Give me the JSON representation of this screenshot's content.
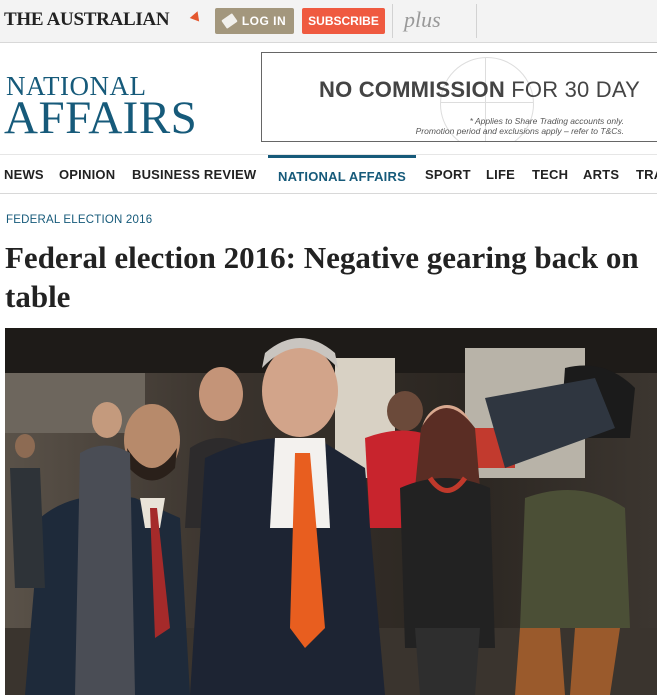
{
  "topbar": {
    "logo": "THE AUSTRALIAN",
    "login_label": "LOG IN",
    "subscribe_label": "SUBSCRIBE",
    "plus_label": "plus"
  },
  "masthead": {
    "section_line1": "NATIONAL",
    "section_line2": "AFFAIRS"
  },
  "ad": {
    "headline_bold": "NO COMMISSION",
    "headline_rest": " FOR 30 DAY",
    "fine_print_1": "* Applies to Share Trading accounts only.",
    "fine_print_2": "Promotion period and exclusions apply – refer to T&Cs."
  },
  "nav": {
    "items": [
      {
        "label": "NEWS"
      },
      {
        "label": "OPINION"
      },
      {
        "label": "BUSINESS REVIEW"
      },
      {
        "label": "NATIONAL AFFAIRS",
        "active": true
      },
      {
        "label": "SPORT"
      },
      {
        "label": "LIFE"
      },
      {
        "label": "TECH"
      },
      {
        "label": "ARTS"
      },
      {
        "label": "TRA"
      }
    ]
  },
  "article": {
    "kicker": "FEDERAL ELECTION 2016",
    "headline": "Federal election 2016: Negative gearing back on table"
  },
  "colors": {
    "brand_blue": "#165a7a",
    "subscribe_red": "#ef5a40",
    "login_tan": "#a3977d"
  }
}
